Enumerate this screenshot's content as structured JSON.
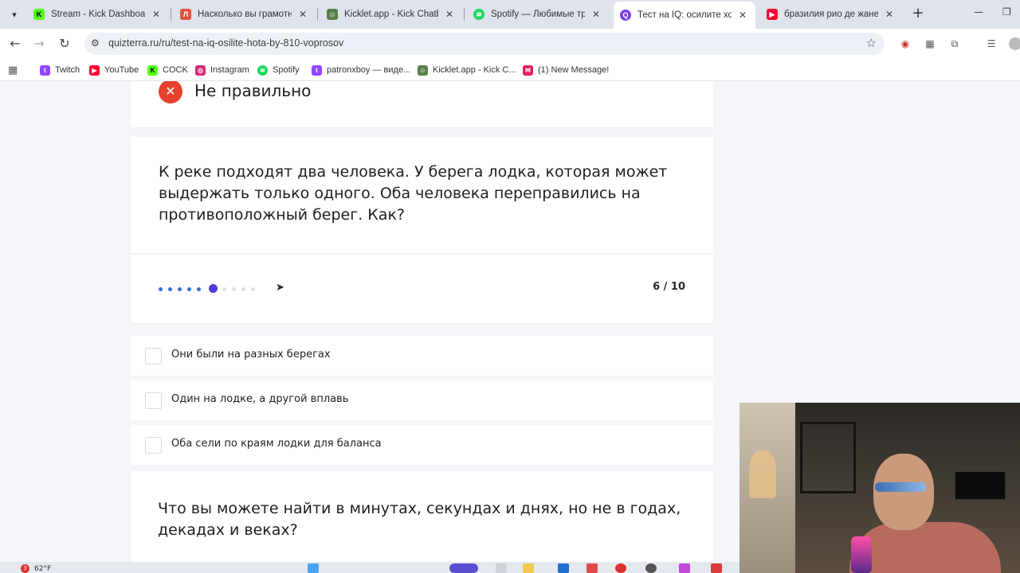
{
  "browser": {
    "tabs": [
      {
        "title": "Stream - Kick Dashboard",
        "favicon": "kick-icon",
        "color": "#53fc18",
        "active": false
      },
      {
        "title": "Насколько вы грамотны?",
        "favicon": "quiz-icon",
        "color": "#e0533a",
        "active": false
      },
      {
        "title": "Kicklet.app - Kick Chatbot",
        "favicon": "kicklet-icon",
        "color": "#5b7f4c",
        "active": false
      },
      {
        "title": "Spotify — Любимые треки",
        "favicon": "spotify-icon",
        "color": "#1ed760",
        "active": false
      },
      {
        "title": "Тест на IQ: осилите хотя бы",
        "favicon": "quizterra-icon",
        "color": "#7b3fe4",
        "active": true
      },
      {
        "title": "бразилия рио де жанейро",
        "favicon": "youtube-icon",
        "color": "#ff0033",
        "active": false
      }
    ],
    "url": "quizterra.ru/ru/test-na-iq-osilite-hota-by-810-voprosov",
    "bookmarks": [
      {
        "label": "Twitch",
        "icon": "twitch-icon",
        "color": "#9146ff"
      },
      {
        "label": "YouTube",
        "icon": "youtube-icon",
        "color": "#ff0033"
      },
      {
        "label": "COCK",
        "icon": "kick-icon",
        "color": "#53fc18"
      },
      {
        "label": "Instagram",
        "icon": "instagram-icon",
        "color": "#d62976"
      },
      {
        "label": "Spotify",
        "icon": "spotify-icon",
        "color": "#1ed760"
      },
      {
        "label": "patronxboy — виде...",
        "icon": "twitch-icon",
        "color": "#9146ff"
      },
      {
        "label": "Kicklet.app - Kick C...",
        "icon": "kicklet-icon",
        "color": "#5b7f4c"
      },
      {
        "label": "(1) New Message!",
        "icon": "message-icon",
        "color": "#e91e63"
      }
    ]
  },
  "quiz": {
    "result_text": "Не правильно",
    "question": "К реке подходят два человека. У берега лодка, которая может выдержать только одного. Оба человека переправились на противоположный берег. Как?",
    "progress": {
      "current": 6,
      "total": 10,
      "label": "6 / 10"
    },
    "options": [
      "Они были на разных берегах",
      "Один на лодке, а другой вплавь",
      "Оба сели по краям лодки для баланса"
    ],
    "next_question": "Что вы можете найти в минутах, секундах и днях, но не в годах, декадах и веках?"
  },
  "taskbar": {
    "weather": "62°F",
    "notification_count": "3"
  },
  "colors": {
    "wrong": "#e6402f",
    "dot_done": "#2f6fd9",
    "dot_current": "#4b3bd8",
    "dot_todo": "#dcdfe4"
  }
}
